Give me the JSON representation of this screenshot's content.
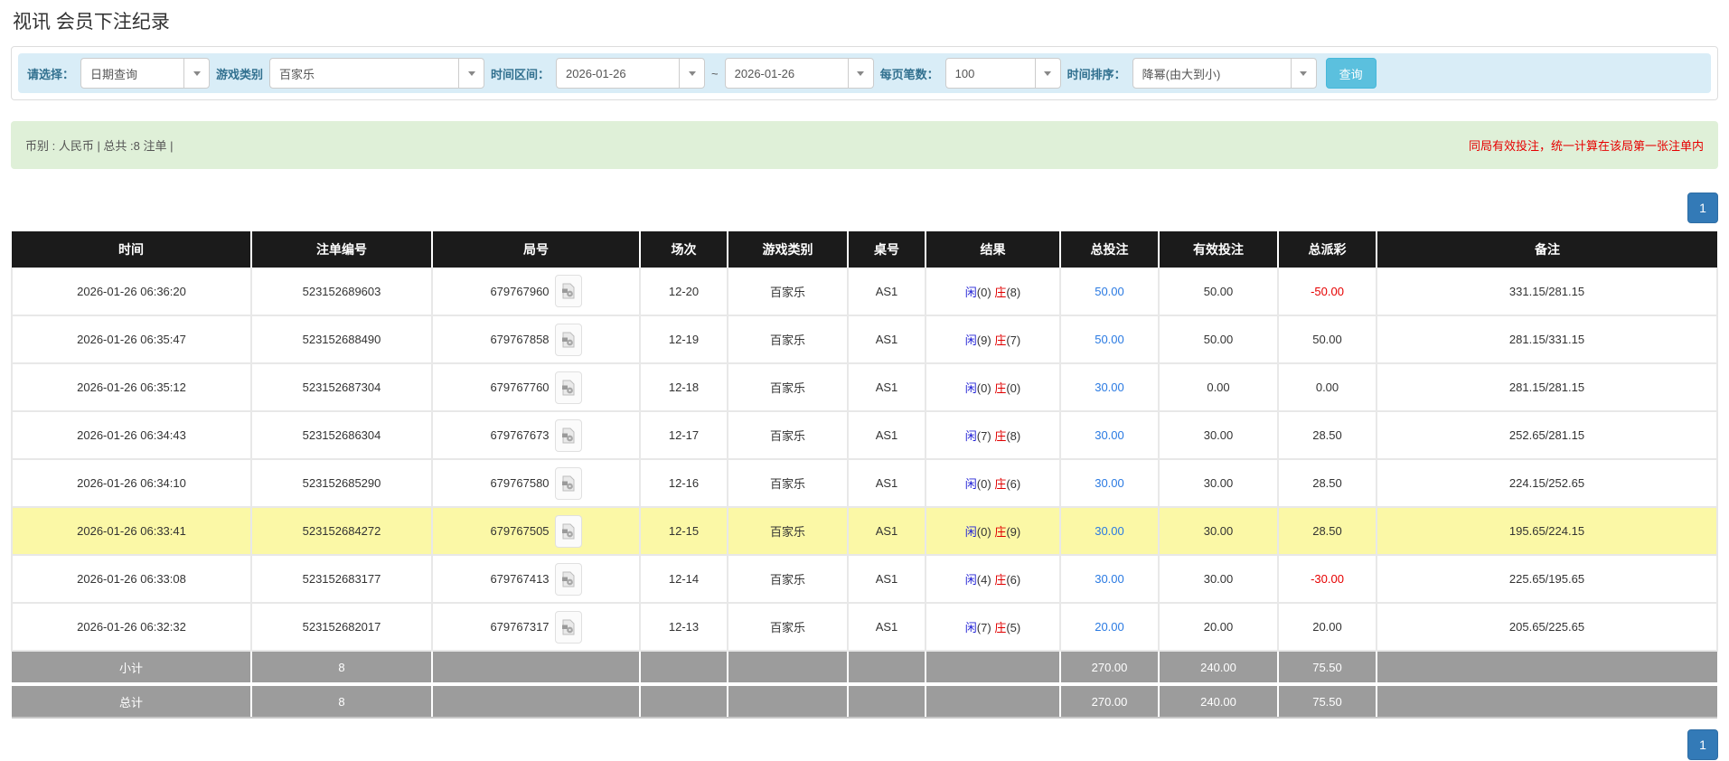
{
  "page": {
    "title": "视讯 会员下注纪录"
  },
  "filter_bar": {
    "mode_label": "请选择：",
    "mode_value": "日期查询",
    "game_type_label": "游戏类别",
    "game_type_value": "百家乐",
    "time_range_label": "时间区间：",
    "date_from": "2026-01-26",
    "tilde": "~",
    "date_to": "2026-01-26",
    "page_size_label": "每页笔数：",
    "page_size_value": "100",
    "sort_label": "时间排序：",
    "sort_value": "降幂(由大到小)",
    "query_button_label": "查询"
  },
  "summary_bar": {
    "left_text": "币别 : 人民币 | 总共 :8 注单 |",
    "right_notice": "同局有效投注，统一计算在该局第一张注单内"
  },
  "pagination": {
    "page_label": "1"
  },
  "table": {
    "headers": [
      "时间",
      "注单编号",
      "局号",
      "场次",
      "游戏类别",
      "桌号",
      "结果",
      "总投注",
      "有效投注",
      "总派彩",
      "备注"
    ],
    "result_labels": {
      "player": "闲",
      "banker": "庄"
    },
    "icons": {
      "round_video": "video-file-icon",
      "select_caret": "chevron-down-icon"
    },
    "rows": [
      {
        "time": "2026-01-26 06:36:20",
        "bet_id": "523152689603",
        "round_id": "679767960",
        "session": "12-20",
        "game_type": "百家乐",
        "table_no": "AS1",
        "player_score": "0",
        "banker_score": "8",
        "total_bet": "50.00",
        "valid_bet": "50.00",
        "total_payout": "-50.00",
        "remark": "331.15/281.15",
        "highlight": false
      },
      {
        "time": "2026-01-26 06:35:47",
        "bet_id": "523152688490",
        "round_id": "679767858",
        "session": "12-19",
        "game_type": "百家乐",
        "table_no": "AS1",
        "player_score": "9",
        "banker_score": "7",
        "total_bet": "50.00",
        "valid_bet": "50.00",
        "total_payout": "50.00",
        "remark": "281.15/331.15",
        "highlight": false
      },
      {
        "time": "2026-01-26 06:35:12",
        "bet_id": "523152687304",
        "round_id": "679767760",
        "session": "12-18",
        "game_type": "百家乐",
        "table_no": "AS1",
        "player_score": "0",
        "banker_score": "0",
        "total_bet": "30.00",
        "valid_bet": "0.00",
        "total_payout": "0.00",
        "remark": "281.15/281.15",
        "highlight": false
      },
      {
        "time": "2026-01-26 06:34:43",
        "bet_id": "523152686304",
        "round_id": "679767673",
        "session": "12-17",
        "game_type": "百家乐",
        "table_no": "AS1",
        "player_score": "7",
        "banker_score": "8",
        "total_bet": "30.00",
        "valid_bet": "30.00",
        "total_payout": "28.50",
        "remark": "252.65/281.15",
        "highlight": false
      },
      {
        "time": "2026-01-26 06:34:10",
        "bet_id": "523152685290",
        "round_id": "679767580",
        "session": "12-16",
        "game_type": "百家乐",
        "table_no": "AS1",
        "player_score": "0",
        "banker_score": "6",
        "total_bet": "30.00",
        "valid_bet": "30.00",
        "total_payout": "28.50",
        "remark": "224.15/252.65",
        "highlight": false
      },
      {
        "time": "2026-01-26 06:33:41",
        "bet_id": "523152684272",
        "round_id": "679767505",
        "session": "12-15",
        "game_type": "百家乐",
        "table_no": "AS1",
        "player_score": "0",
        "banker_score": "9",
        "total_bet": "30.00",
        "valid_bet": "30.00",
        "total_payout": "28.50",
        "remark": "195.65/224.15",
        "highlight": true
      },
      {
        "time": "2026-01-26 06:33:08",
        "bet_id": "523152683177",
        "round_id": "679767413",
        "session": "12-14",
        "game_type": "百家乐",
        "table_no": "AS1",
        "player_score": "4",
        "banker_score": "6",
        "total_bet": "30.00",
        "valid_bet": "30.00",
        "total_payout": "-30.00",
        "remark": "225.65/195.65",
        "highlight": false
      },
      {
        "time": "2026-01-26 06:32:32",
        "bet_id": "523152682017",
        "round_id": "679767317",
        "session": "12-13",
        "game_type": "百家乐",
        "table_no": "AS1",
        "player_score": "7",
        "banker_score": "5",
        "total_bet": "20.00",
        "valid_bet": "20.00",
        "total_payout": "20.00",
        "remark": "205.65/225.65",
        "highlight": false
      }
    ],
    "subtotal": {
      "label": "小计",
      "count": "8",
      "total_bet": "270.00",
      "valid_bet": "240.00",
      "total_payout": "75.50"
    },
    "total": {
      "label": "总计",
      "count": "8",
      "total_bet": "270.00",
      "valid_bet": "240.00",
      "total_payout": "75.50"
    }
  },
  "colors": {
    "header_bg": "#1b1b1b",
    "filter_blue": "#d9edf7",
    "summary_green": "#dff0d8",
    "highlight_yellow": "#fbf8a6",
    "subtotal_grey": "#9c9c9c",
    "link_blue": "#2a7ae2",
    "player_blue": "#2222d6",
    "banker_red": "#e00000",
    "negative_red": "#e60000",
    "button_blue": "#5bc0de",
    "pagination_blue": "#337ab7",
    "label_blue": "#31708f"
  }
}
